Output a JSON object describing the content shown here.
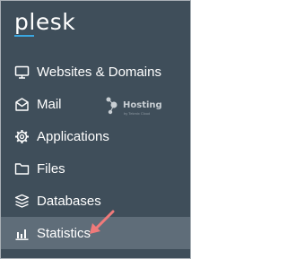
{
  "brand": {
    "logo_text": "plesk",
    "accent": "#3aa6e0"
  },
  "sidebar": {
    "background": "#3f4e5a",
    "active_background": "#5f6d79",
    "items": [
      {
        "label": "Websites & Domains",
        "icon": "monitor-icon"
      },
      {
        "label": "Mail",
        "icon": "envelope-icon"
      },
      {
        "label": "Applications",
        "icon": "gear-icon"
      },
      {
        "label": "Files",
        "icon": "folder-icon"
      },
      {
        "label": "Databases",
        "icon": "database-icon"
      },
      {
        "label": "Statistics",
        "icon": "bar-chart-icon",
        "active": true
      }
    ]
  },
  "watermark": {
    "text": "Hosting",
    "subtext": "by Tekmix Cloud"
  },
  "annotation": {
    "arrow_color": "#f07a7a"
  }
}
